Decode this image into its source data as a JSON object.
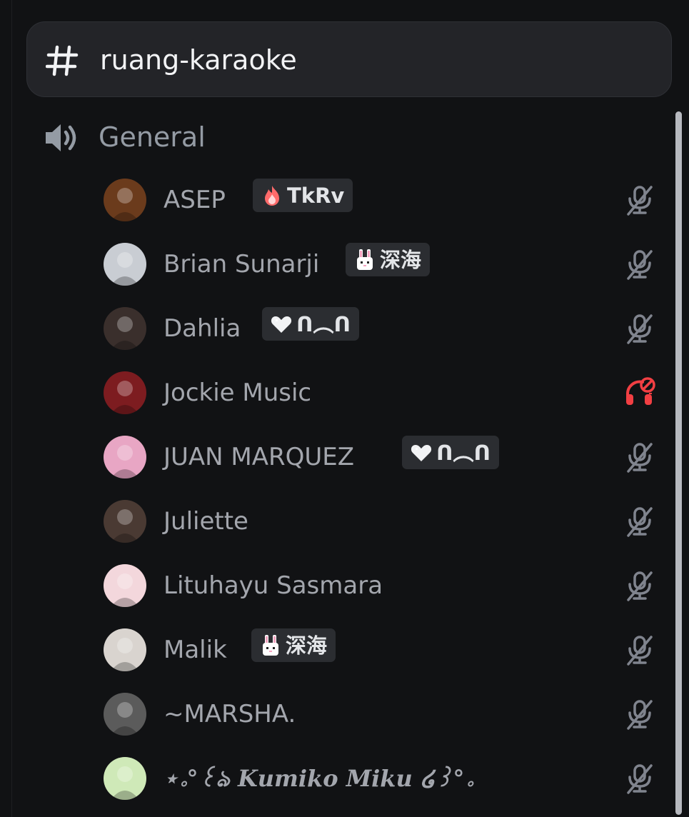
{
  "channel": {
    "name": "ruang-karaoke",
    "icon": "hash-icon"
  },
  "voice_channel": {
    "name": "General",
    "icon": "speaker-icon"
  },
  "members": [
    {
      "name": "ASEP",
      "tag": "TkRv",
      "tag_icon": "flame-icon",
      "status_icon": "mic-muted-icon",
      "avatar_color": "#6b3b1c"
    },
    {
      "name": "Brian Sunarji",
      "tag": "深海",
      "tag_icon": "bunny-icon",
      "status_icon": "mic-muted-icon",
      "avatar_color": "#c9cdd3"
    },
    {
      "name": "Dahlia",
      "tag": "ᑎ︵ᑎ",
      "tag_icon": "heart-icon",
      "status_icon": "mic-muted-icon",
      "avatar_color": "#3a2f2c"
    },
    {
      "name": "Jockie Music",
      "tag": "",
      "tag_icon": "",
      "status_icon": "deafened-icon",
      "avatar_color": "#7d1c20"
    },
    {
      "name": "JUAN MARQUEZ",
      "tag": "ᑎ︵ᑎ",
      "tag_icon": "heart-icon",
      "status_icon": "mic-muted-icon",
      "avatar_color": "#e8a6c4"
    },
    {
      "name": "Juliette",
      "tag": "",
      "tag_icon": "",
      "status_icon": "mic-muted-icon",
      "avatar_color": "#4a3a33"
    },
    {
      "name": "Lituhayu Sasmara",
      "tag": "",
      "tag_icon": "",
      "status_icon": "mic-muted-icon",
      "avatar_color": "#f3d7dc"
    },
    {
      "name": "Malik",
      "tag": "深海",
      "tag_icon": "bunny-icon",
      "status_icon": "mic-muted-icon",
      "avatar_color": "#d9d4cf"
    },
    {
      "name": "~MARSHA.",
      "tag": "",
      "tag_icon": "",
      "status_icon": "mic-muted-icon",
      "avatar_color": "#5b5b5b"
    },
    {
      "name": "⋆｡°꒰ঌ 𝑲𝒖𝒎𝒊𝒌𝒐 𝑴𝒊𝒌𝒖 ໒꒱°｡",
      "tag": "",
      "tag_icon": "",
      "status_icon": "mic-muted-icon",
      "avatar_color": "#cfe9b8"
    }
  ],
  "colors": {
    "background": "#111214",
    "header_bg": "#232428",
    "tag_bg": "#2b2d31",
    "muted_icon": "#80848e",
    "deafened_icon": "#f23f43",
    "name_text": "#a3a6ad"
  }
}
